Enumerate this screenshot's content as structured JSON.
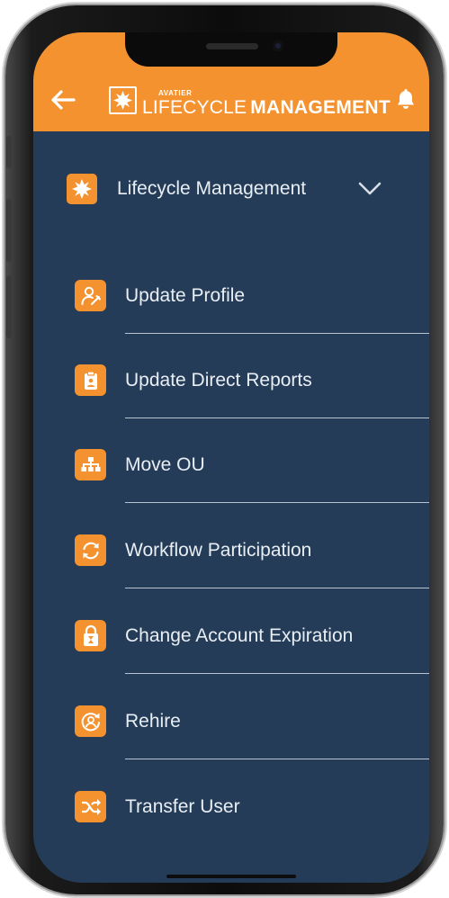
{
  "header": {
    "logo_brand": "AVATIER",
    "logo_lifecycle": "LIFECYCLE",
    "logo_management": "MANAGEMENT",
    "back_icon": "arrow-left-icon",
    "bell_icon": "bell-icon"
  },
  "section": {
    "label": "Lifecycle Management",
    "icon": "star-burst-icon",
    "chevron_icon": "chevron-down-icon",
    "expanded": true
  },
  "menu_items": [
    {
      "label": "Update Profile",
      "icon": "user-edit-icon"
    },
    {
      "label": "Update Direct Reports",
      "icon": "clipboard-icon"
    },
    {
      "label": "Move OU",
      "icon": "org-chart-icon"
    },
    {
      "label": "Workflow Participation",
      "icon": "sync-icon"
    },
    {
      "label": "Change Account Expiration",
      "icon": "lock-hourglass-icon"
    },
    {
      "label": "Rehire",
      "icon": "user-refresh-icon"
    },
    {
      "label": "Transfer User",
      "icon": "shuffle-icon"
    }
  ],
  "colors": {
    "accent": "#f4922f",
    "background": "#243c57",
    "text": "#e9eef4",
    "divider": "#b8c4d0"
  }
}
